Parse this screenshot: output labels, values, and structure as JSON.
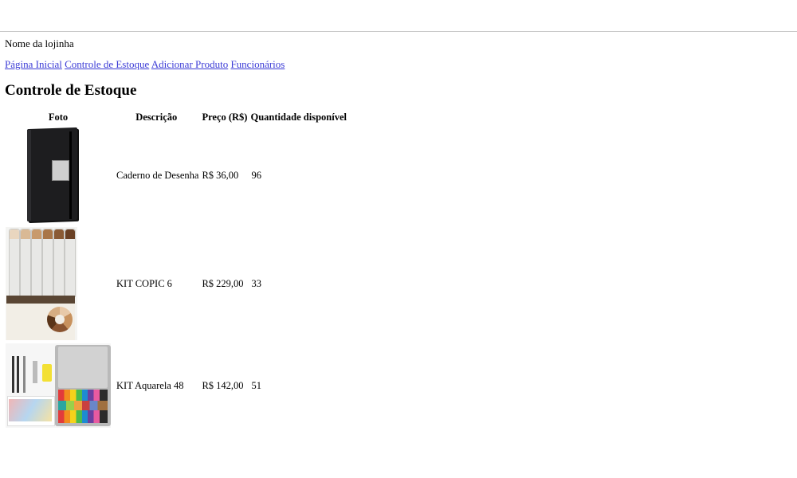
{
  "store": {
    "name": "Nome da lojinha"
  },
  "nav": [
    {
      "label": "Página Inicial"
    },
    {
      "label": "Controle de Estoque"
    },
    {
      "label": "Adicionar Produto"
    },
    {
      "label": "Funcionários"
    }
  ],
  "page": {
    "title": "Controle de Estoque"
  },
  "table": {
    "headers": [
      "Foto",
      "Descrição",
      "Preço (R$)",
      "Quantidade disponível"
    ],
    "rows": [
      {
        "photo": "sketchbook-image",
        "description": "Caderno de Desenha",
        "price": "R$ 36,00",
        "quantity": "96"
      },
      {
        "photo": "markers-kit-image",
        "description": "KIT COPIC 6",
        "price": "R$ 229,00",
        "quantity": "33"
      },
      {
        "photo": "watercolor-kit-image",
        "description": "KIT Aquarela 48",
        "price": "R$ 142,00",
        "quantity": "51"
      }
    ]
  }
}
